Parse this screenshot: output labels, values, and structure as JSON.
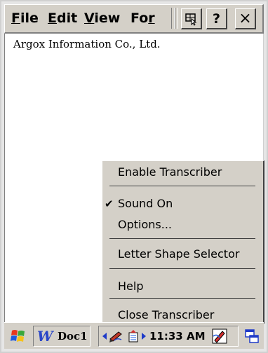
{
  "menubar": {
    "items": [
      {
        "label_u": "F",
        "label_rest": "ile"
      },
      {
        "label_u": "E",
        "label_rest": "dit"
      },
      {
        "label_u": "V",
        "label_rest": "iew"
      },
      {
        "label_pre": "Fo",
        "label_u": "r",
        "label_rest": ""
      }
    ],
    "help_label": "?",
    "close_label": "×"
  },
  "document": {
    "text": "Argox Information Co., Ltd."
  },
  "popup_menu": {
    "items": [
      {
        "label": "Enable Transcriber",
        "checked": false
      },
      {
        "label": "Sound On",
        "checked": true
      },
      {
        "label": "Options...",
        "checked": false
      },
      {
        "label": "Letter Shape Selector",
        "checked": false
      },
      {
        "label": "Help",
        "checked": false
      },
      {
        "label": "Close Transcriber",
        "checked": false
      }
    ],
    "check_glyph": "✔"
  },
  "taskbar": {
    "doc_button_label": "Doc1",
    "clock": "11:33 AM"
  }
}
